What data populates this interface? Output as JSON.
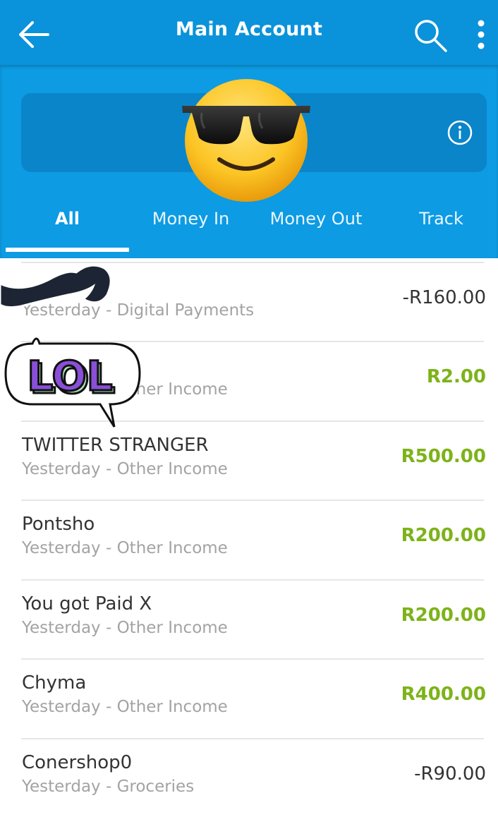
{
  "appbar": {
    "title": "Main Account",
    "back_icon": "arrow-left-icon",
    "search_icon": "search-icon",
    "more_icon": "more-vertical-icon"
  },
  "header": {
    "info_icon": "info-icon"
  },
  "tabs": [
    {
      "label": "All",
      "active": true
    },
    {
      "label": "Money In",
      "active": false
    },
    {
      "label": "Money Out",
      "active": false
    },
    {
      "label": "Track",
      "active": false
    }
  ],
  "transactions": [
    {
      "name": "",
      "subtitle": "Yesterday - Digital Payments",
      "amount": "-R160.00",
      "direction": "out"
    },
    {
      "name": "",
      "subtitle": "Yesterday - Other Income",
      "amount": "R2.00",
      "direction": "in"
    },
    {
      "name": "TWITTER STRANGER",
      "subtitle": "Yesterday - Other Income",
      "amount": "R500.00",
      "direction": "in"
    },
    {
      "name": "Pontsho",
      "subtitle": "Yesterday - Other Income",
      "amount": "R200.00",
      "direction": "in"
    },
    {
      "name": "You got Paid X",
      "subtitle": "Yesterday - Other Income",
      "amount": "R200.00",
      "direction": "in"
    },
    {
      "name": "Chyma",
      "subtitle": "Yesterday - Other Income",
      "amount": "R400.00",
      "direction": "in"
    },
    {
      "name": "Conershop0",
      "subtitle": "Yesterday - Groceries",
      "amount": "-R90.00",
      "direction": "out"
    }
  ],
  "stickers": {
    "emoji": "sunglasses-emoji-sticker",
    "mustache": "mustache-sticker",
    "lol": {
      "text": "LOL",
      "icon": "lol-speech-bubble-sticker"
    }
  },
  "colors": {
    "appbar": "#0a92da",
    "header": "#0d9be3",
    "card": "#0a85c9",
    "income": "#7db319",
    "expense": "#333333",
    "subtitle": "#a3a3a3"
  }
}
